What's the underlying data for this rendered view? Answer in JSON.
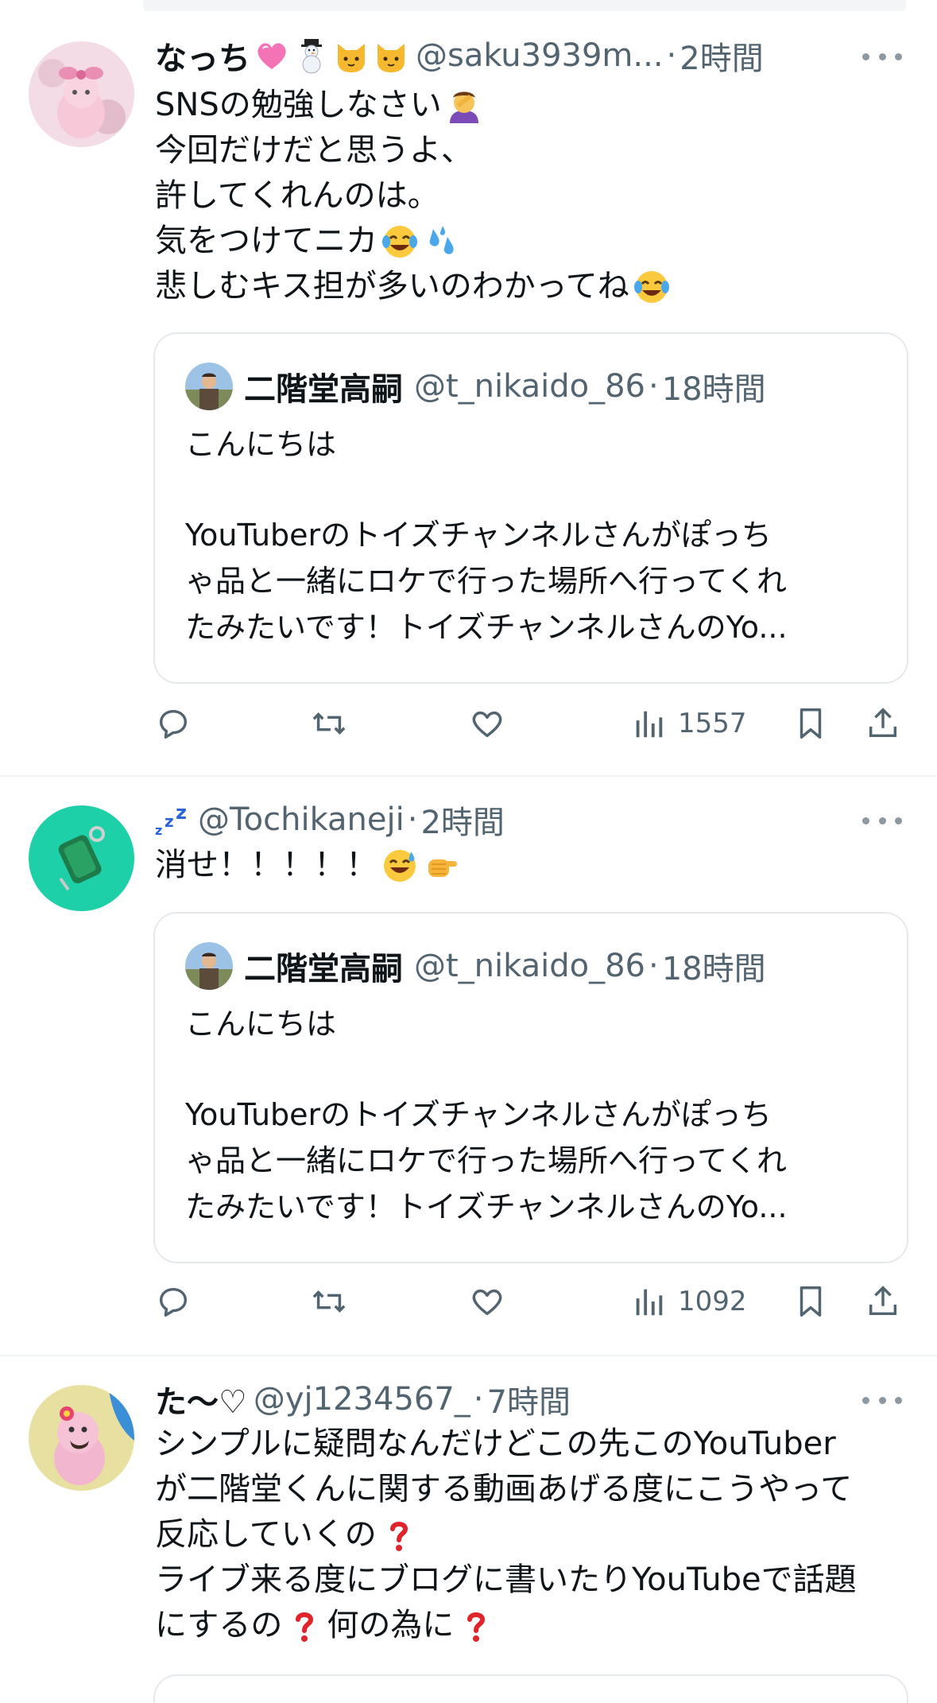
{
  "tweets": [
    {
      "name": "なっち",
      "name_emojis": [
        "pink-heart",
        "snowman",
        "cat-face",
        "cat-face"
      ],
      "handle": "@saku3939m...",
      "dot": "·",
      "time": "2時間",
      "lines": [
        "SNSの勉強しなさい",
        "今回だけだと思うよ、",
        "許してくれんのは。",
        "気をつけてニカ",
        "悲しむキス担が多いのわかってね"
      ],
      "quote": {
        "name": "二階堂高嗣",
        "handle": "@t_nikaido_86",
        "dot": "·",
        "time": "18時間",
        "lines": [
          "こんにちは",
          "",
          "YouTuberのトイズチャンネルさんがぽっち",
          "ゃ品と一緒にロケで行った場所へ行ってくれ",
          "たみたいです！トイズチャンネルさんのYo..."
        ]
      },
      "views": "1557"
    },
    {
      "name": "",
      "name_emojis": [
        "zzz"
      ],
      "handle": "@Tochikaneji",
      "dot": "·",
      "time": "2時間",
      "lines": [
        "消せ！！！！！"
      ],
      "quote": {
        "name": "二階堂高嗣",
        "handle": "@t_nikaido_86",
        "dot": "·",
        "time": "18時間",
        "lines": [
          "こんにちは",
          "",
          "YouTuberのトイズチャンネルさんがぽっち",
          "ゃ品と一緒にロケで行った場所へ行ってくれ",
          "たみたいです！トイズチャンネルさんのYo..."
        ]
      },
      "views": "1092"
    },
    {
      "name": "た〜♡",
      "name_emojis": [],
      "handle": "@yj1234567_",
      "dot": "·",
      "time": "7時間",
      "lines": [
        "シンプルに疑問なんだけどこの先このYouTuber",
        "が二階堂くんに関する動画あげる度にこうやって",
        "反応していくの",
        "ライブ来る度にブログに書いたりYouTubeで話題",
        "にするの",
        "何の為に"
      ]
    }
  ],
  "colors": {
    "text": "#0f1419",
    "secondary": "#536471",
    "border": "#eff3f4",
    "icon": "#536471"
  },
  "icons": [
    "reply-icon",
    "retweet-icon",
    "like-icon",
    "views-icon",
    "bookmark-icon",
    "share-icon",
    "more-icon"
  ]
}
